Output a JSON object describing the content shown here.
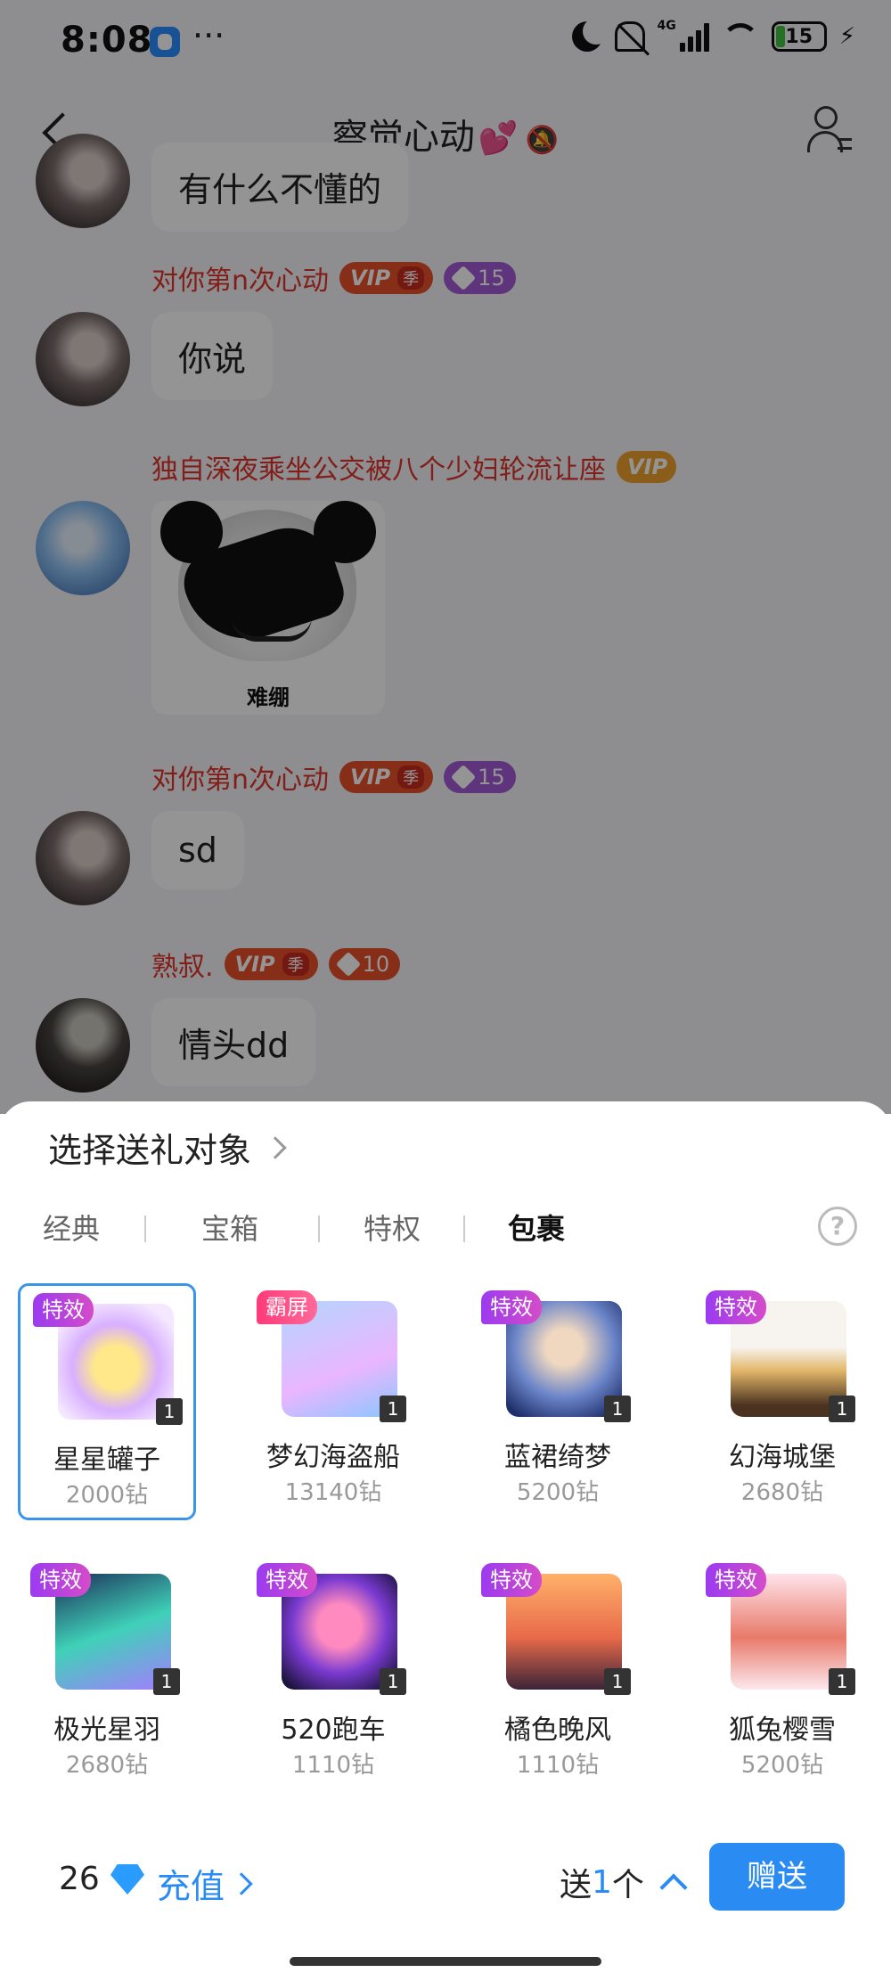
{
  "status_bar": {
    "time": "8:08",
    "dots": "···",
    "network": "4G",
    "battery": "15"
  },
  "header": {
    "title": "察觉心动",
    "title_icon": "💕"
  },
  "messages": [
    {
      "id": "m0",
      "sender": "",
      "text": "有什么不懂的"
    },
    {
      "id": "m1",
      "sender": "对你第n次心动",
      "vip": "VIP",
      "season": "季",
      "level": "15",
      "text": "你说"
    },
    {
      "id": "m2",
      "sender": "独自深夜乘坐公交被八个少妇轮流让座",
      "vip": "VIP",
      "sticker_caption": "难绷"
    },
    {
      "id": "m3",
      "sender": "对你第n次心动",
      "vip": "VIP",
      "season": "季",
      "level": "15",
      "text": "sd"
    },
    {
      "id": "m4",
      "sender": "熟叔.",
      "vip": "VIP",
      "season": "季",
      "level": "10",
      "text": "情头dd"
    }
  ],
  "gift_panel": {
    "target_label": "选择送礼对象",
    "tabs": [
      "经典",
      "宝箱",
      "特权",
      "包裹"
    ],
    "active_tab": "包裹",
    "gifts": [
      {
        "name": "星星罐子",
        "price": "2000钻",
        "tag": "特效",
        "qty": "1",
        "selected": true
      },
      {
        "name": "梦幻海盗船",
        "price": "13140钻",
        "tag": "霸屏",
        "qty": "1"
      },
      {
        "name": "蓝裙绮梦",
        "price": "5200钻",
        "tag": "特效",
        "qty": "1"
      },
      {
        "name": "幻海城堡",
        "price": "2680钻",
        "tag": "特效",
        "qty": "1"
      },
      {
        "name": "极光星羽",
        "price": "2680钻",
        "tag": "特效",
        "qty": "1"
      },
      {
        "name": "520跑车",
        "price": "1110钻",
        "tag": "特效",
        "qty": "1"
      },
      {
        "name": "橘色晚风",
        "price": "1110钻",
        "tag": "特效",
        "qty": "1"
      },
      {
        "name": "狐兔樱雪",
        "price": "5200钻",
        "tag": "特效",
        "qty": "1"
      }
    ],
    "balance": "26",
    "recharge_label": "充值",
    "send_prefix": "送",
    "send_count": "1",
    "send_suffix": "个",
    "send_button": "赠送"
  },
  "colors": {
    "accent": "#2a8cf2",
    "vip_red": "#e8502c",
    "level_purple": "#a25bd8",
    "sender_red": "#e0352c"
  },
  "icons": [
    "back-arrow-icon",
    "heart-icon",
    "mute-icon",
    "group-members-icon",
    "chevron-right-icon",
    "help-icon",
    "diamond-icon",
    "chevron-up-icon"
  ]
}
